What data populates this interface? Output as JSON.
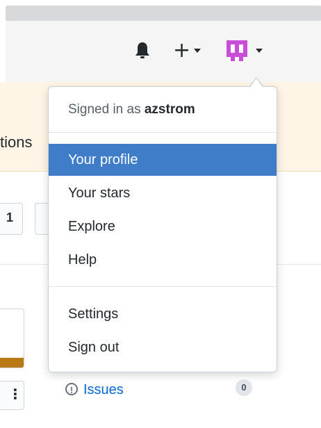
{
  "header": {
    "notifications_icon": "bell-icon",
    "create_icon": "plus-icon",
    "avatar_icon": "identicon-avatar",
    "avatar_color": "#c94dd6"
  },
  "background": {
    "partial_text": "tions",
    "tab_count": "1",
    "issues_label": "Issues",
    "issues_count": "0",
    "warning_color": "#fff5e6"
  },
  "user_menu": {
    "signed_in_prefix": "Signed in as",
    "username": "azstrom",
    "items": [
      {
        "label": "Your profile",
        "active": true
      },
      {
        "label": "Your stars"
      },
      {
        "label": "Explore"
      },
      {
        "label": "Help"
      },
      {
        "label": "Settings"
      },
      {
        "label": "Sign out"
      }
    ],
    "active_color": "#3f7dc8"
  }
}
